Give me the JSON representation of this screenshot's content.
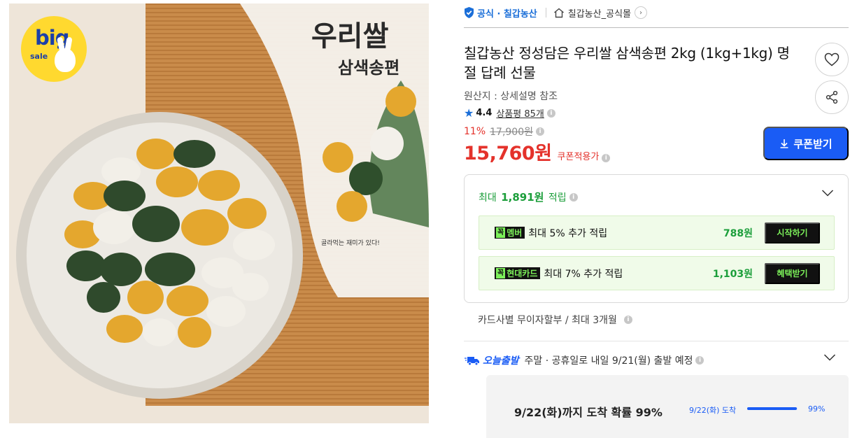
{
  "badge": {
    "big": "big",
    "sale": "sale"
  },
  "package": {
    "brand": "우리쌀",
    "name": "삼색송편",
    "tagline": "골라먹는 재미가 있다!"
  },
  "header": {
    "official_label": "공식 · 칠갑농산",
    "store_name": "칠갑농산_공식몰"
  },
  "product": {
    "title": "칠갑농산 정성담은 우리쌀 삼색송편 2kg (1kg+1kg) 명절 답례 선물",
    "origin": "원산지 : 상세설명 참조",
    "rating": "4.4",
    "review_label": "상품평 85개",
    "discount_pct": "11%",
    "original_price": "17,900원",
    "price": "15,760원",
    "coupon_note": "쿠폰적용가",
    "coupon_button": "쿠폰받기"
  },
  "points": {
    "prefix": "최대",
    "amount": "1,891원",
    "suffix": "적립",
    "benefits": [
      {
        "badge_k": "꼭",
        "badge": "멤버",
        "text": "최대 5% 추가 적립",
        "amount": "788원",
        "action": "시작하기"
      },
      {
        "badge_k": "꼭",
        "badge": "현대카드",
        "text": "최대 7% 추가 적립",
        "amount": "1,103원",
        "action": "혜택받기"
      }
    ]
  },
  "installment": "카드사별 무이자할부 / 최대 3개월",
  "delivery": {
    "badge": "오늘출발",
    "text": "주말 · 공휴일로 내일 9/21(월) 출발 예정",
    "arrival_main": "9/22(화)까지 도착 확률 99%",
    "arrival_label": "9/22(화) 도착",
    "arrival_pct": "99%",
    "arrival_fraction": 0.99
  },
  "colors": {
    "accent": "#1a5cf5",
    "price": "#e4322b",
    "points": "#1b9e3a",
    "badge_green": "#7cf05a"
  },
  "icons": [
    "shield-check-icon",
    "home-icon",
    "chevron-right-icon",
    "heart-icon",
    "share-icon",
    "download-icon",
    "star-icon",
    "info-icon",
    "chevron-down-icon",
    "truck-icon"
  ]
}
